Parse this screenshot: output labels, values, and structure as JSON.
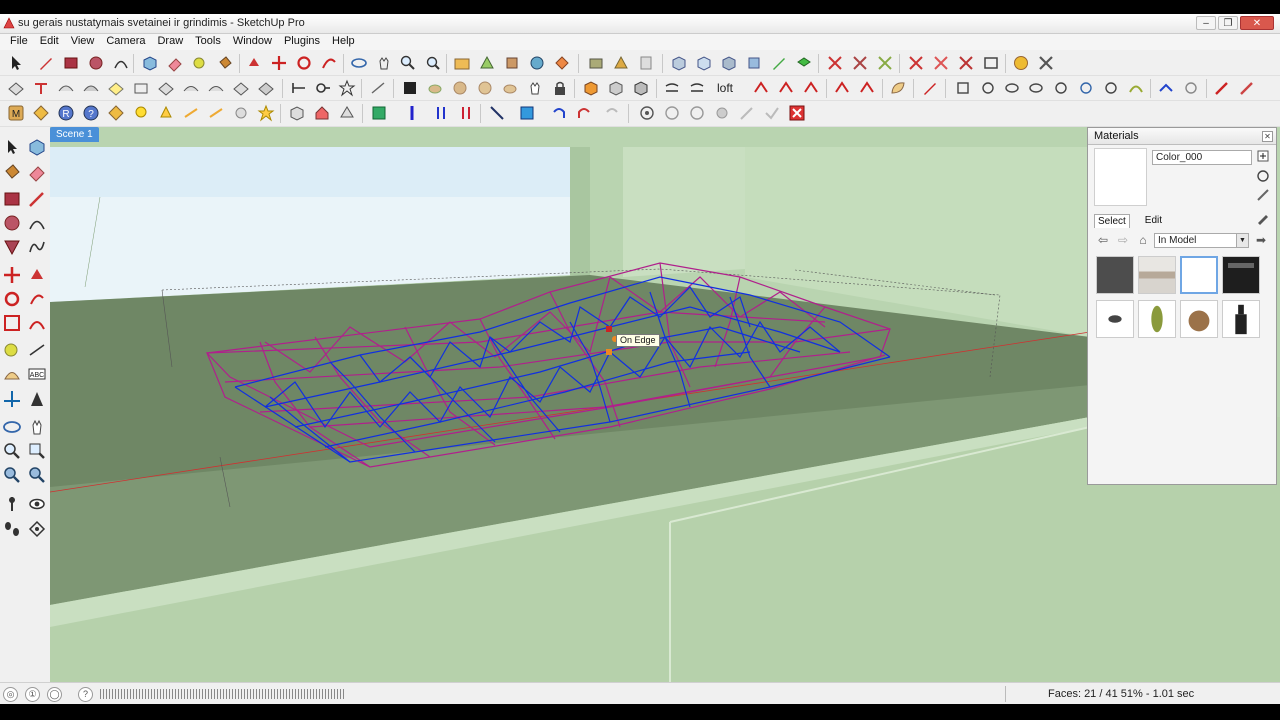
{
  "window": {
    "title": "su gerais nustatymais svetainei ir grindimis - SketchUp Pro",
    "buttons": [
      "–",
      "❐",
      "✕"
    ]
  },
  "menu": [
    "File",
    "Edit",
    "View",
    "Camera",
    "Draw",
    "Tools",
    "Window",
    "Plugins",
    "Help"
  ],
  "toolbar": {
    "loft_label": "loft"
  },
  "scene": {
    "tab_label": "Scene 1",
    "tooltip": "On Edge"
  },
  "materials": {
    "title": "Materials",
    "current_name": "Color_000",
    "tab_select": "Select",
    "tab_edit": "Edit",
    "collection": "In Model",
    "swatches": [
      "dark-gray",
      "interior-photo",
      "white",
      "black-box",
      "white-cup",
      "green-leaf",
      "wood-figure",
      "wine-bottle"
    ]
  },
  "status": {
    "faces": "Faces: 21 / 41",
    "zoom": "51%",
    "time": "- 1.01 sec"
  },
  "colors": {
    "viewport_bg": "#b7d1ac",
    "sky": "#dcedf7",
    "wall": "#b9d4b0",
    "sill_top": "#6f8765",
    "wire_magenta": "#b0208c",
    "wire_blue": "#1030e0",
    "axis_red": "#d03030"
  }
}
